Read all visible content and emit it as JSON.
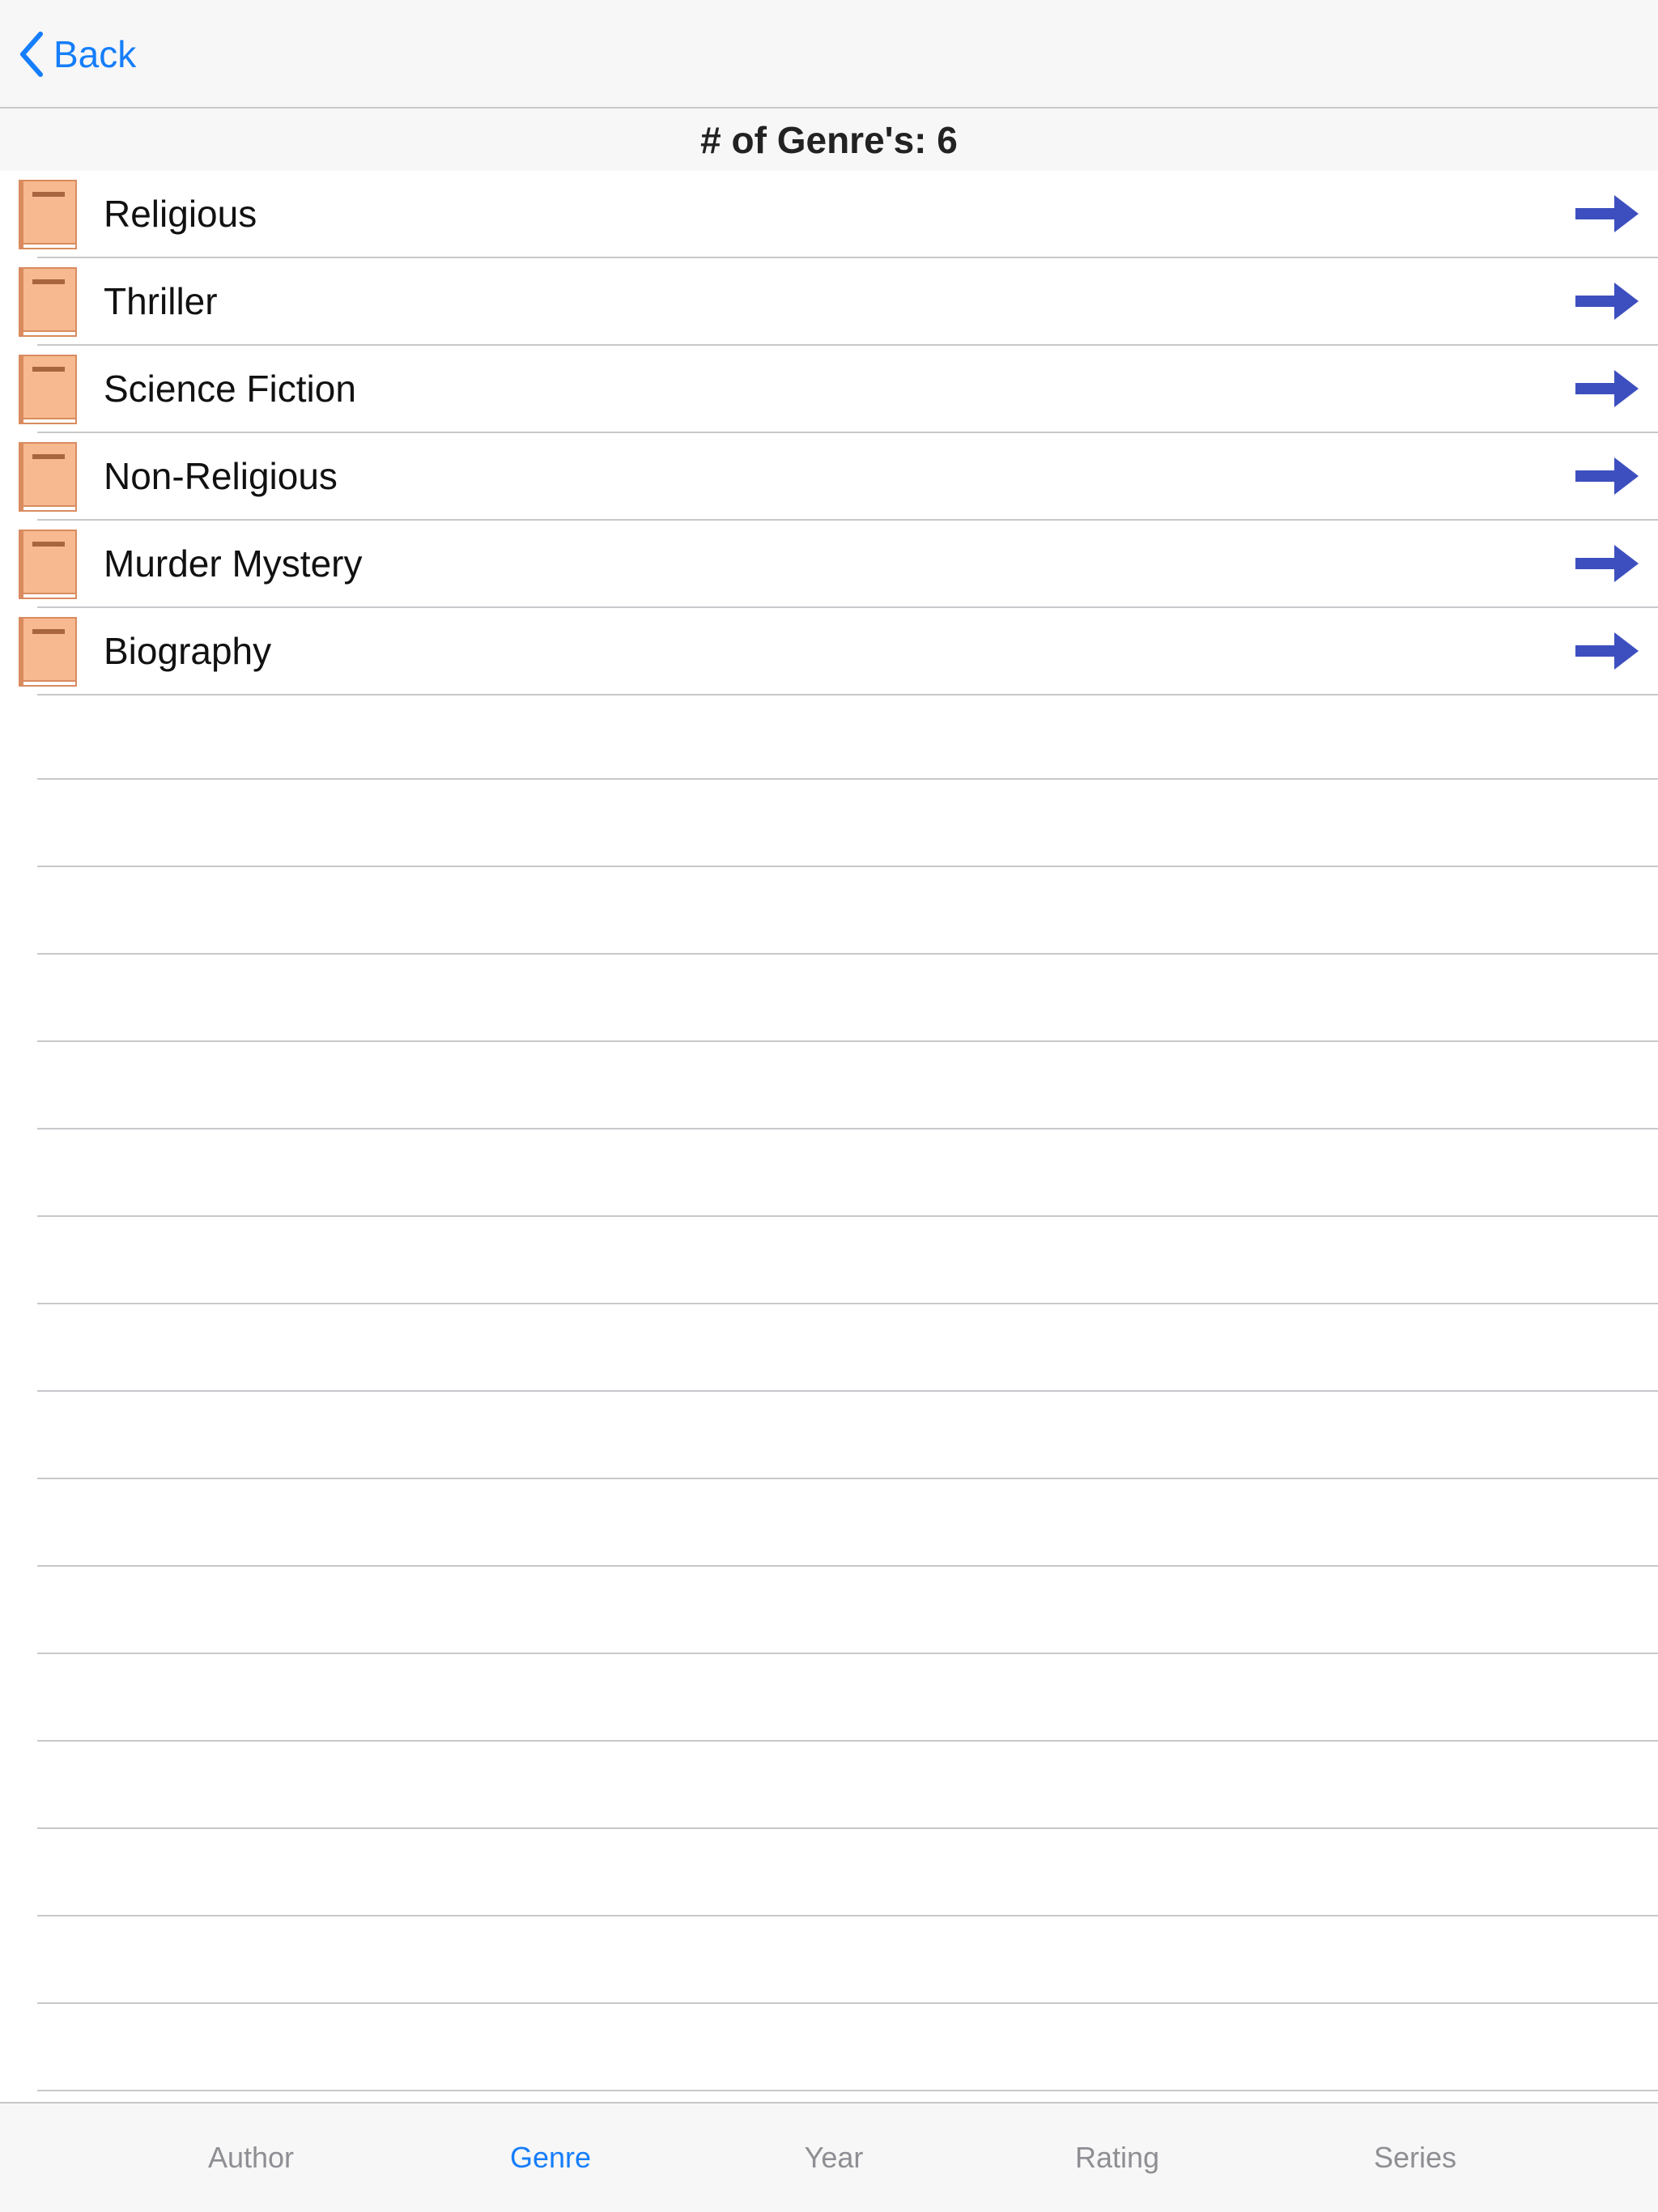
{
  "nav": {
    "back_label": "Back",
    "accent_color": "#157efb"
  },
  "header": {
    "title": "# of Genre's: 6"
  },
  "genres": [
    {
      "label": "Religious"
    },
    {
      "label": "Thriller"
    },
    {
      "label": "Science Fiction"
    },
    {
      "label": "Non-Religious"
    },
    {
      "label": "Murder Mystery"
    },
    {
      "label": "Biography"
    }
  ],
  "tabs": [
    {
      "label": "Author",
      "active": false
    },
    {
      "label": "Genre",
      "active": true
    },
    {
      "label": "Year",
      "active": false
    },
    {
      "label": "Rating",
      "active": false
    },
    {
      "label": "Series",
      "active": false
    }
  ],
  "icons": {
    "row_icon": "book-icon",
    "row_accessory": "right-arrow-icon",
    "back_icon": "chevron-left-icon"
  },
  "colors": {
    "book_cover": "#f7b98f",
    "book_spine": "#d98b5f",
    "arrow": "#3d4fbf",
    "separator": "#c8c8cc"
  }
}
